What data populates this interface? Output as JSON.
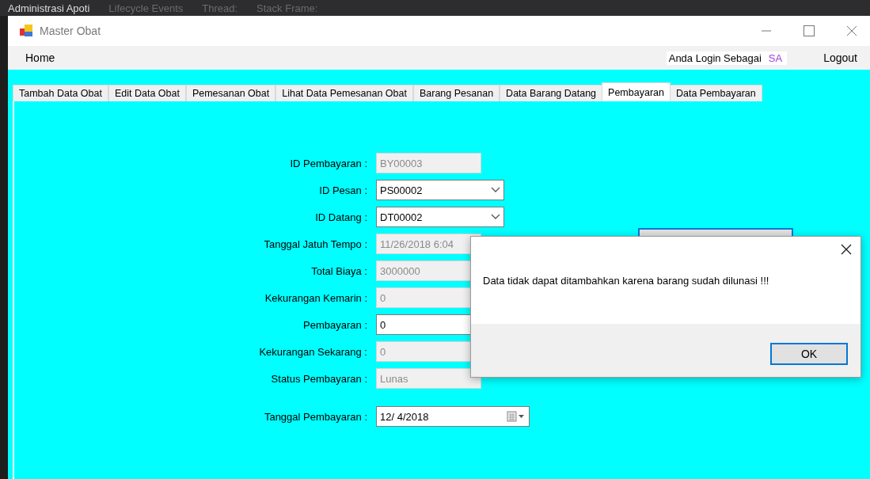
{
  "ide_bar": {
    "items": [
      "Administrasi Apoti",
      "Lifecycle Events",
      "Thread:",
      "Stack Frame:"
    ]
  },
  "window": {
    "title": "Master Obat"
  },
  "menu": {
    "home": "Home",
    "login_label": "Anda Login Sebagai",
    "user": "SA",
    "logout": "Logout"
  },
  "tabs": [
    {
      "label": "Tambah Data Obat",
      "selected": false
    },
    {
      "label": "Edit Data Obat",
      "selected": false
    },
    {
      "label": "Pemesanan Obat",
      "selected": false
    },
    {
      "label": "Lihat Data Pemesanan Obat",
      "selected": false
    },
    {
      "label": "Barang Pesanan",
      "selected": false
    },
    {
      "label": "Data Barang Datang",
      "selected": false
    },
    {
      "label": "Pembayaran",
      "selected": true
    },
    {
      "label": "Data Pembayaran",
      "selected": false
    }
  ],
  "form": [
    {
      "label": "ID Pembayaran :",
      "value": "BY00003",
      "kind": "readonly"
    },
    {
      "label": "ID Pesan :",
      "value": "PS00002",
      "kind": "combo"
    },
    {
      "label": "ID Datang :",
      "value": "DT00002",
      "kind": "combo"
    },
    {
      "label": "Tanggal Jatuh Tempo :",
      "value": "11/26/2018 6:04",
      "kind": "readonly"
    },
    {
      "label": "Total Biaya :",
      "value": "3000000",
      "kind": "readonly"
    },
    {
      "label": "Kekurangan Kemarin :",
      "value": "0",
      "kind": "readonly"
    },
    {
      "label": "Pembayaran :",
      "value": "0",
      "kind": "text"
    },
    {
      "label": "Kekurangan Sekarang :",
      "value": "0",
      "kind": "readonly"
    },
    {
      "label": "Status Pembayaran :",
      "value": "Lunas",
      "kind": "readonly"
    },
    {
      "label": "Tanggal Pembayaran :",
      "value": "12/  4/2018",
      "kind": "date"
    }
  ],
  "dialog": {
    "message": "Data tidak dapat ditambahkan karena barang sudah dilunasi !!!",
    "button": "OK"
  }
}
